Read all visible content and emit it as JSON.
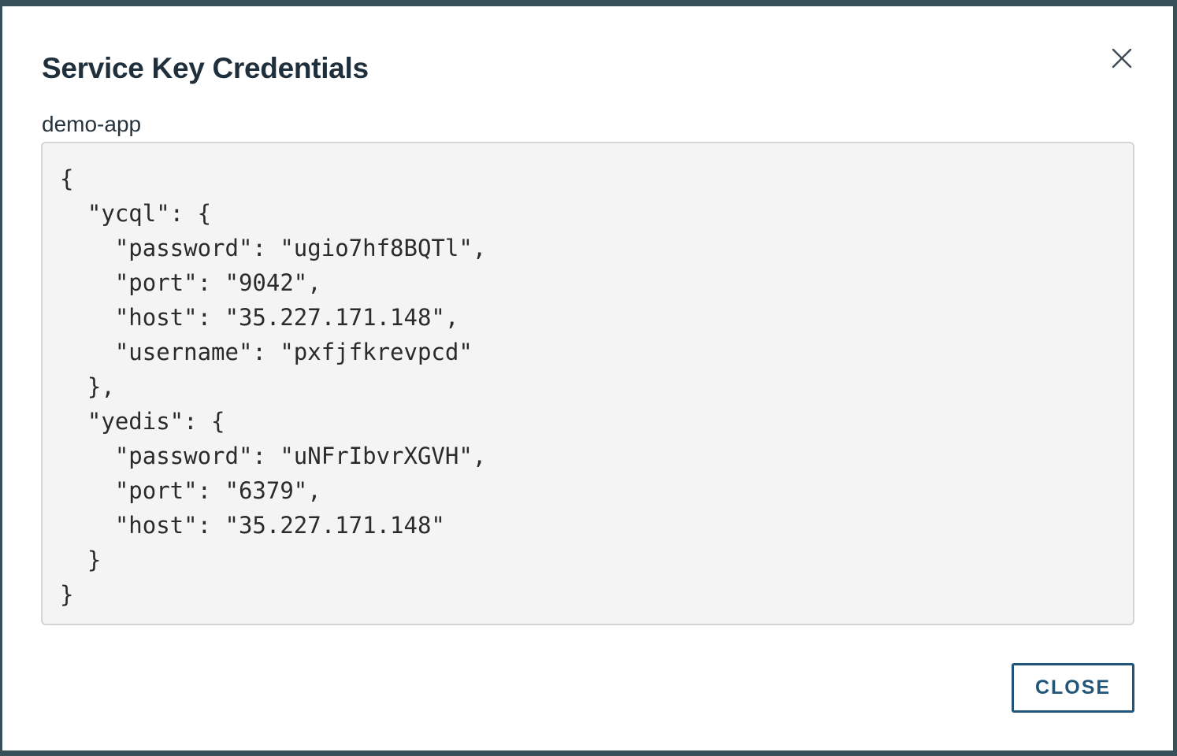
{
  "dialog": {
    "title": "Service Key Credentials",
    "service_name": "demo-app",
    "credentials_json": "{\n  \"ycql\": {\n    \"password\": \"ugio7hf8BQTl\",\n    \"port\": \"9042\",\n    \"host\": \"35.227.171.148\",\n    \"username\": \"pxfjfkrevpcd\"\n  },\n  \"yedis\": {\n    \"password\": \"uNFrIbvrXGVH\",\n    \"port\": \"6379\",\n    \"host\": \"35.227.171.148\"\n  }\n}",
    "close_button_label": "CLOSE",
    "close_icon": "close-icon"
  },
  "colors": {
    "title_text": "#1f2f3b",
    "accent": "#21557a",
    "code_background": "#f4f4f4",
    "code_border": "#d4d4d4",
    "backdrop": "#37505a"
  }
}
